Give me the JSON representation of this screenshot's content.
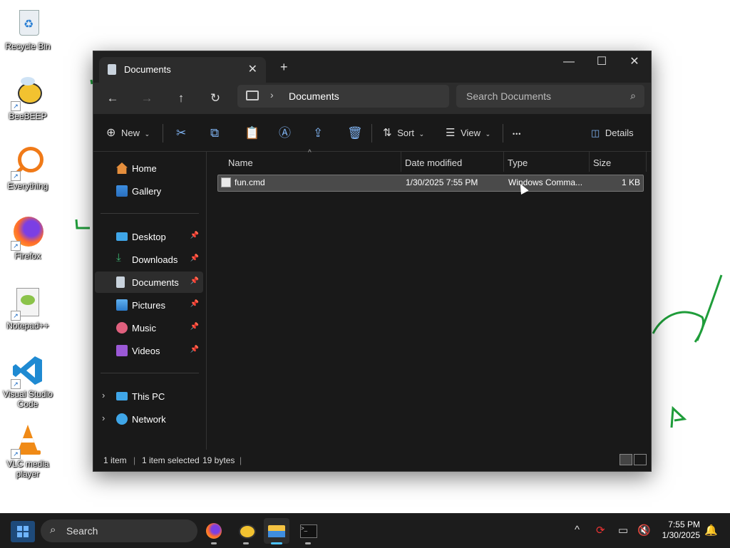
{
  "desktop": {
    "icons": [
      {
        "label": "Recycle Bin"
      },
      {
        "label": "BeeBEEP"
      },
      {
        "label": "Everything"
      },
      {
        "label": "Firefox"
      },
      {
        "label": "Notepad++"
      },
      {
        "label": "Visual Studio Code"
      },
      {
        "label": "VLC media player"
      }
    ]
  },
  "window": {
    "tab_title": "Documents",
    "new_tab_label": "+",
    "address": {
      "crumb": "Documents"
    },
    "search": {
      "placeholder": "Search Documents"
    },
    "toolbar": {
      "new_label": "New",
      "sort_label": "Sort",
      "view_label": "View",
      "more_label": "•••",
      "details_label": "Details"
    },
    "sidebar": {
      "items": [
        {
          "label": "Home",
          "icon": "home-icon"
        },
        {
          "label": "Gallery",
          "icon": "gallery-icon"
        },
        {
          "label": "Desktop",
          "icon": "desktop-icon",
          "pinned": true
        },
        {
          "label": "Downloads",
          "icon": "downloads-icon",
          "pinned": true
        },
        {
          "label": "Documents",
          "icon": "documents-icon",
          "pinned": true,
          "selected": true
        },
        {
          "label": "Pictures",
          "icon": "pictures-icon",
          "pinned": true
        },
        {
          "label": "Music",
          "icon": "music-icon",
          "pinned": true
        },
        {
          "label": "Videos",
          "icon": "videos-icon",
          "pinned": true
        },
        {
          "label": "This PC",
          "icon": "pc-icon"
        },
        {
          "label": "Network",
          "icon": "network-icon"
        }
      ]
    },
    "columns": {
      "name": "Name",
      "date": "Date modified",
      "type": "Type",
      "size": "Size"
    },
    "files": [
      {
        "name": "fun.cmd",
        "date": "1/30/2025 7:55 PM",
        "type": "Windows Comma...",
        "size": "1 KB",
        "selected": true
      }
    ],
    "status": {
      "count": "1 item",
      "selected": "1 item selected",
      "size": "19 bytes"
    }
  },
  "taskbar": {
    "search_label": "Search",
    "apps": [
      "firefox-icon",
      "beebeep-icon",
      "file-explorer-icon",
      "terminal-icon"
    ],
    "active_app": "file-explorer-icon",
    "time": "7:55 PM",
    "date": "1/30/2025"
  },
  "colors": {
    "accent": "#4cc2ff",
    "window_bg": "#191919",
    "scribble": "#1f9d3a"
  }
}
